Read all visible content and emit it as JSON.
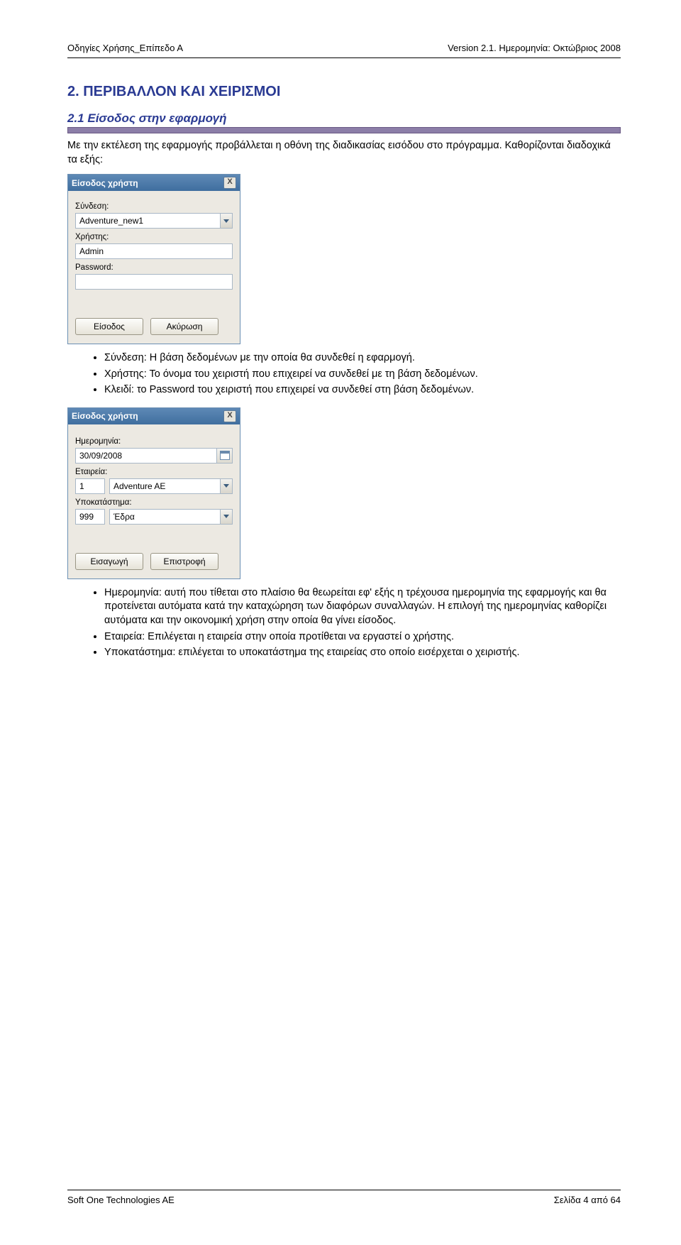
{
  "header": {
    "left": "Οδηγίες Χρήσης_Επίπεδο Α",
    "right": "Version 2.1. Ημερομηνία: Οκτώβριος 2008"
  },
  "section": {
    "number_title": "2.    ΠΕΡΙΒΑΛΛΟΝ ΚΑΙ ΧΕΙΡΙΣΜΟΙ",
    "sub_title": "2.1 Είσοδος στην εφαρμογή",
    "intro": "Με την εκτέλεση της εφαρμογής προβάλλεται η οθόνη της διαδικασίας εισόδου στο πρόγραμμα. Καθορίζονται διαδοχικά τα εξής:"
  },
  "dialog1": {
    "title": "Είσοδος χρήστη",
    "labels": {
      "connection": "Σύνδεση:",
      "user": "Χρήστης:",
      "password": "Password:"
    },
    "values": {
      "connection": "Adventure_new1",
      "user": "Admin",
      "password": ""
    },
    "buttons": {
      "login": "Είσοδος",
      "cancel": "Ακύρωση"
    }
  },
  "bullets1": [
    "Σύνδεση: Η βάση δεδομένων με την οποία θα συνδεθεί η εφαρμογή.",
    "Χρήστης: Το όνομα του χειριστή που επιχειρεί να συνδεθεί με τη βάση δεδομένων.",
    "Κλειδί: το Password του χειριστή που επιχειρεί να συνδεθεί στη βάση δεδομένων."
  ],
  "dialog2": {
    "title": "Είσοδος χρήστη",
    "labels": {
      "date": "Ημερομηνία:",
      "company": "Εταιρεία:",
      "branch": "Υποκατάστημα:"
    },
    "values": {
      "date": "30/09/2008",
      "company_code": "1",
      "company_name": "Adventure AE",
      "branch_code": "999",
      "branch_name": "Έδρα"
    },
    "buttons": {
      "enter": "Εισαγωγή",
      "back": "Επιστροφή"
    }
  },
  "bullets2": [
    "Ημερομηνία: αυτή που τίθεται στο πλαίσιο θα θεωρείται εφ' εξής η τρέχουσα ημερομηνία της εφαρμογής και θα προτείνεται αυτόματα κατά την καταχώρηση των διαφόρων συναλλαγών. Η επιλογή της ημερομηνίας καθορίζει αυτόματα και την οικονομική χρήση στην οποία θα γίνει είσοδος.",
    "Εταιρεία: Επιλέγεται η εταιρεία στην οποία προτίθεται να εργαστεί ο χρήστης.",
    "Υποκατάστημα: επιλέγεται το υποκατάστημα της εταιρείας στο οποίο εισέρχεται ο χειριστής."
  ],
  "footer": {
    "left": "Soft One Technologies AE",
    "right": "Σελίδα 4 από 64"
  }
}
